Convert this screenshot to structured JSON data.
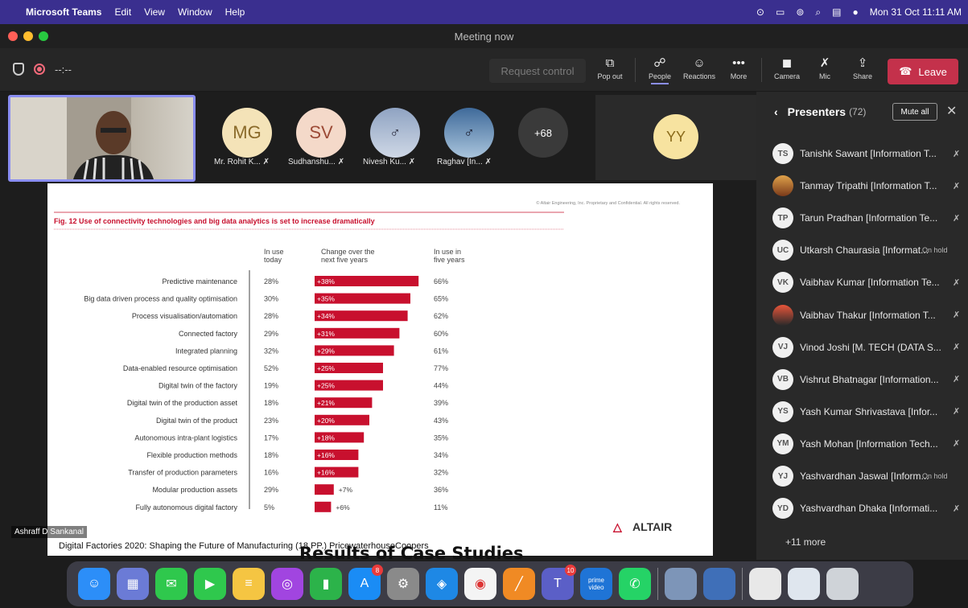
{
  "menubar": {
    "app": "Microsoft Teams",
    "items": [
      "Edit",
      "View",
      "Window",
      "Help"
    ],
    "datetime": "Mon 31 Oct  11:11 AM"
  },
  "window": {
    "title": "Meeting now"
  },
  "toolbar": {
    "timer": "--:--",
    "request_control": "Request control",
    "pop_out": "Pop out",
    "people": "People",
    "reactions": "Reactions",
    "more": "More",
    "camera": "Camera",
    "mic": "Mic",
    "share": "Share",
    "leave": "Leave"
  },
  "participants": [
    {
      "initials": "MG",
      "name": "Mr. Rohit K...",
      "color": "#f4e3b8"
    },
    {
      "initials": "SV",
      "name": "Sudhanshu...",
      "color": "#f4d9c9"
    },
    {
      "initials": "",
      "name": "Nivesh Ku...",
      "color": "#8fa0b8"
    },
    {
      "initials": "",
      "name": "Raghav [In...",
      "color": "#4a6a8e"
    }
  ],
  "overflow_count": "+68",
  "yy_tile": "YY",
  "slide": {
    "copyright": "© Altair Engineering, Inc. Proprietary and Confidential. All rights reserved.",
    "figure_title": "Fig. 12  Use of connectivity technologies and big data analytics is set to increase dramatically",
    "col_today": "In use today",
    "col_change": "Change over the next five years",
    "col_future": "In use in five years",
    "source": "Digital Factories 2020: Shaping the Future of Manufacturing (18 PP.) PricewaterhouseCoopers",
    "brand": "ALTAIR"
  },
  "chart_data": {
    "type": "bar",
    "title": "Fig. 12  Use of connectivity technologies and big data analytics is set to increase dramatically",
    "categories": [
      "Predictive maintenance",
      "Big data driven process and quality optimisation",
      "Process visualisation/automation",
      "Connected factory",
      "Integrated planning",
      "Data-enabled resource optimisation",
      "Digital twin of the factory",
      "Digital twin of the production asset",
      "Digital twin of the product",
      "Autonomous intra-plant logistics",
      "Flexible production methods",
      "Transfer of production parameters",
      "Modular production assets",
      "Fully autonomous digital factory"
    ],
    "today": [
      "28%",
      "30%",
      "28%",
      "29%",
      "32%",
      "52%",
      "19%",
      "18%",
      "23%",
      "17%",
      "18%",
      "16%",
      "29%",
      "5%"
    ],
    "change": [
      "+38%",
      "+35%",
      "+34%",
      "+31%",
      "+29%",
      "+25%",
      "+25%",
      "+21%",
      "+20%",
      "+18%",
      "+16%",
      "+16%",
      "+7%",
      "+6%"
    ],
    "values": [
      38,
      35,
      34,
      31,
      29,
      25,
      25,
      21,
      20,
      18,
      16,
      16,
      7,
      6
    ],
    "five_years": [
      "66%",
      "65%",
      "62%",
      "60%",
      "61%",
      "77%",
      "44%",
      "39%",
      "43%",
      "35%",
      "34%",
      "32%",
      "36%",
      "11%"
    ],
    "bar_color": "#c8102e"
  },
  "speaker_caption": "Ashraff D Sankanal",
  "overlay_title": "Results of Case Studies",
  "panel": {
    "title": "Presenters",
    "count": "(72)",
    "mute_all": "Mute all",
    "more": "+11 more",
    "people": [
      {
        "initials": "TS",
        "name": "Tanishk Sawant [Information T...",
        "status": "muted"
      },
      {
        "initials": "",
        "name": "Tanmay Tripathi [Information T...",
        "status": "muted"
      },
      {
        "initials": "TP",
        "name": "Tarun Pradhan [Information Te...",
        "status": "muted"
      },
      {
        "initials": "UC",
        "name": "Utkarsh Chaurasia [Informat...",
        "status": "On hold"
      },
      {
        "initials": "VK",
        "name": "Vaibhav Kumar [Information Te...",
        "status": "muted"
      },
      {
        "initials": "",
        "name": "Vaibhav Thakur [Information T...",
        "status": "muted"
      },
      {
        "initials": "VJ",
        "name": "Vinod Joshi [M. TECH (DATA S...",
        "status": "muted"
      },
      {
        "initials": "VB",
        "name": "Vishrut Bhatnagar [Information...",
        "status": "muted"
      },
      {
        "initials": "YS",
        "name": "Yash Kumar Shrivastava [Infor...",
        "status": "muted"
      },
      {
        "initials": "YM",
        "name": "Yash Mohan [Information Tech...",
        "status": "muted"
      },
      {
        "initials": "YJ",
        "name": "Yashvardhan Jaswal [Inform...",
        "status": "On hold"
      },
      {
        "initials": "YD",
        "name": "Yashvardhan Dhaka [Informati...",
        "status": "muted"
      }
    ]
  },
  "dock": {
    "items": [
      {
        "name": "finder-icon",
        "label": "",
        "color": "#2c8ef8"
      },
      {
        "name": "launchpad-icon",
        "label": "",
        "color": "#6b7bd6"
      },
      {
        "name": "messages-icon",
        "label": "",
        "color": "#2fc84d"
      },
      {
        "name": "facetime-icon",
        "label": "",
        "color": "#2fc84d"
      },
      {
        "name": "notes-icon",
        "label": "",
        "color": "#f5c542"
      },
      {
        "name": "podcasts-icon",
        "label": "",
        "color": "#a145e0"
      },
      {
        "name": "numbers-icon",
        "label": "",
        "color": "#2cb34a"
      },
      {
        "name": "app-store-icon",
        "label": "",
        "color": "#1a8cf5",
        "badge": "8"
      },
      {
        "name": "system-preferences-icon",
        "label": "",
        "color": "#8a8a8a"
      },
      {
        "name": "safari-icon",
        "label": "",
        "color": "#1e88e5"
      },
      {
        "name": "chrome-icon",
        "label": "",
        "color": "#f4f4f4"
      },
      {
        "name": "sublime-icon",
        "label": "",
        "color": "#f08a24"
      },
      {
        "name": "teams-icon",
        "label": "",
        "color": "#5b5fc7",
        "badge": "10"
      },
      {
        "name": "prime-video-icon",
        "label": "prime video",
        "color": "#1f74d6"
      },
      {
        "name": "whatsapp-icon",
        "label": "",
        "color": "#25d366"
      }
    ]
  }
}
